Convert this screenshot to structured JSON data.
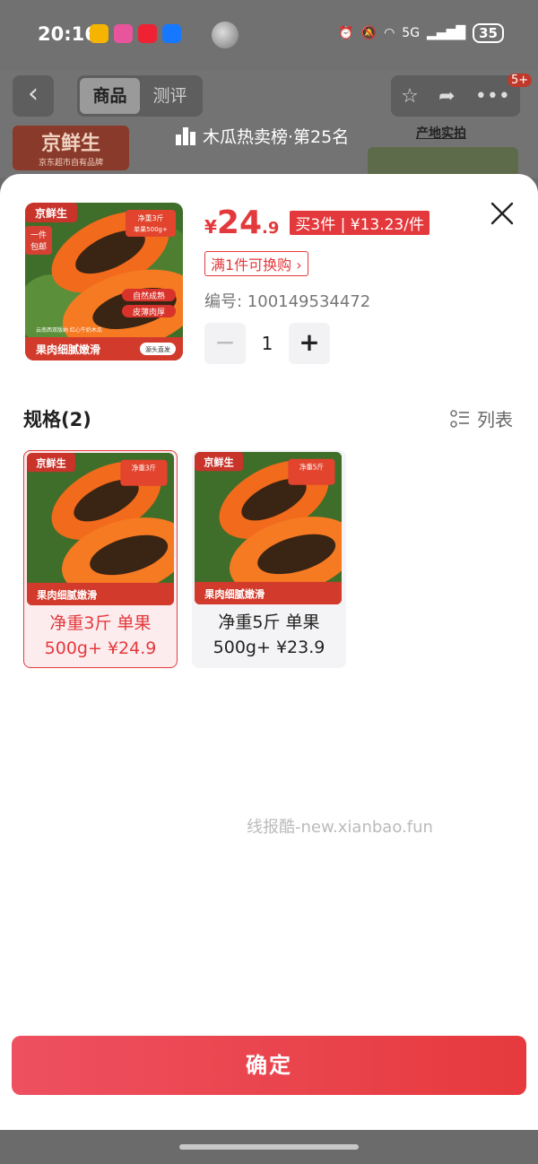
{
  "status_bar": {
    "time": "20:16",
    "network": "5G",
    "battery": "35"
  },
  "background": {
    "tabs": [
      "商品",
      "测评"
    ],
    "badge": "5+",
    "brand": "京鲜生",
    "brand_sub": "京东超市自有品牌",
    "rank": "木瓜热卖榜·第25名",
    "origin_label": "产地实拍"
  },
  "product": {
    "image_brand": "京鲜生",
    "image_texts": [
      "一件",
      "包邮",
      "净重3斤",
      "单果500g+",
      "自然成熟",
      "皮薄肉厚",
      "云南西双版纳 红心牛奶木瓜",
      "果肉细腻嫩滑",
      "源头直发"
    ],
    "currency": "¥",
    "price_int": "24",
    "price_dec": ".9",
    "promo": "买3件 | ¥13.23/件",
    "swap": "满1件可换购 ›",
    "sku": "编号: 100149534472",
    "quantity": "1"
  },
  "spec": {
    "title": "规格(2)",
    "list_label": "列表",
    "options": [
      {
        "line1": "净重3斤 单果",
        "line2": "500g+ ¥24.9",
        "image_weight": "净重3斤",
        "selected": true
      },
      {
        "line1": "净重5斤 单果",
        "line2": "500g+ ¥23.9",
        "image_weight": "净重5斤",
        "selected": false
      }
    ]
  },
  "watermark": "线报酷-new.xianbao.fun",
  "confirm_label": "确定",
  "colors": {
    "accent": "#e4393c",
    "confirm_start": "#ee5060",
    "confirm_end": "#e63a3d"
  }
}
